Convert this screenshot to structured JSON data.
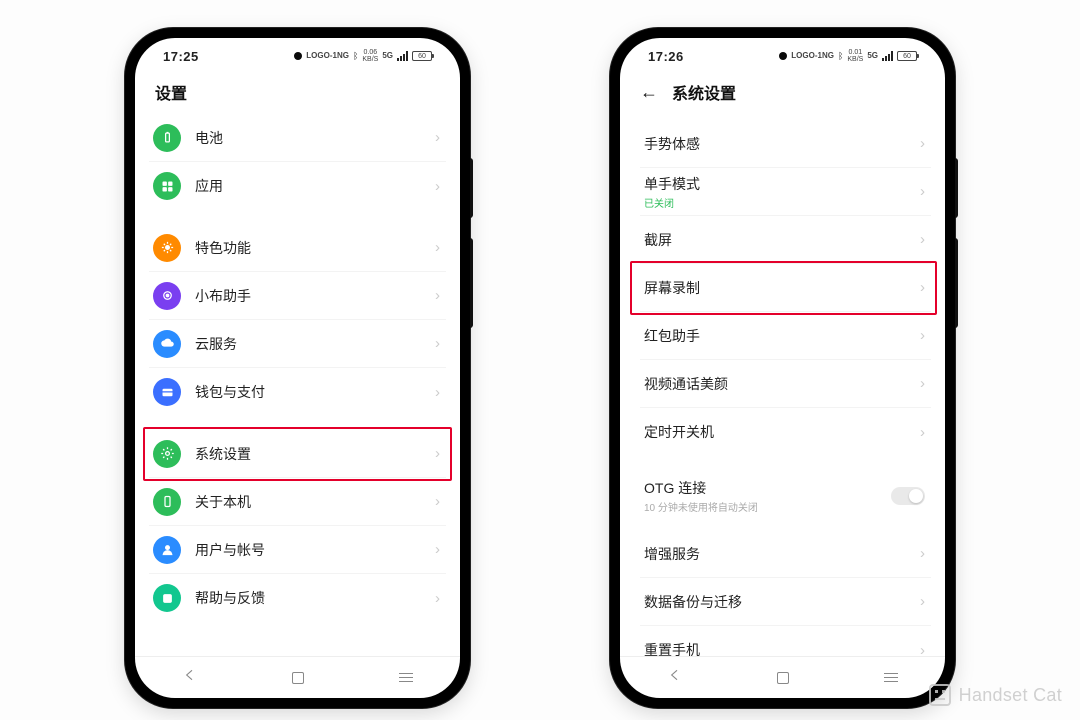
{
  "watermark": "Handset Cat",
  "left": {
    "time": "17:25",
    "net_label": "LOGO-1NG",
    "speed_top": "0.06",
    "speed_unit": "KB/S",
    "sig": "5G",
    "battery": "60",
    "title": "设置",
    "items": [
      {
        "label": "电池"
      },
      {
        "label": "应用"
      },
      {
        "label": "特色功能"
      },
      {
        "label": "小布助手"
      },
      {
        "label": "云服务"
      },
      {
        "label": "钱包与支付"
      },
      {
        "label": "系统设置"
      },
      {
        "label": "关于本机"
      },
      {
        "label": "用户与帐号"
      },
      {
        "label": "帮助与反馈"
      }
    ]
  },
  "right": {
    "time": "17:26",
    "net_label": "LOGO-1NG",
    "speed_top": "0.01",
    "speed_unit": "KB/S",
    "sig": "5G",
    "battery": "60",
    "title": "系统设置",
    "items": [
      {
        "label": "手势体感"
      },
      {
        "label": "单手模式",
        "sub": "已关闭"
      },
      {
        "label": "截屏"
      },
      {
        "label": "屏幕录制"
      },
      {
        "label": "红包助手"
      },
      {
        "label": "视频通话美颜"
      },
      {
        "label": "定时开关机"
      },
      {
        "label": "OTG 连接",
        "subgray": "10 分钟未使用将自动关闭",
        "toggle": true
      },
      {
        "label": "增强服务"
      },
      {
        "label": "数据备份与迁移"
      },
      {
        "label": "重置手机"
      }
    ]
  }
}
